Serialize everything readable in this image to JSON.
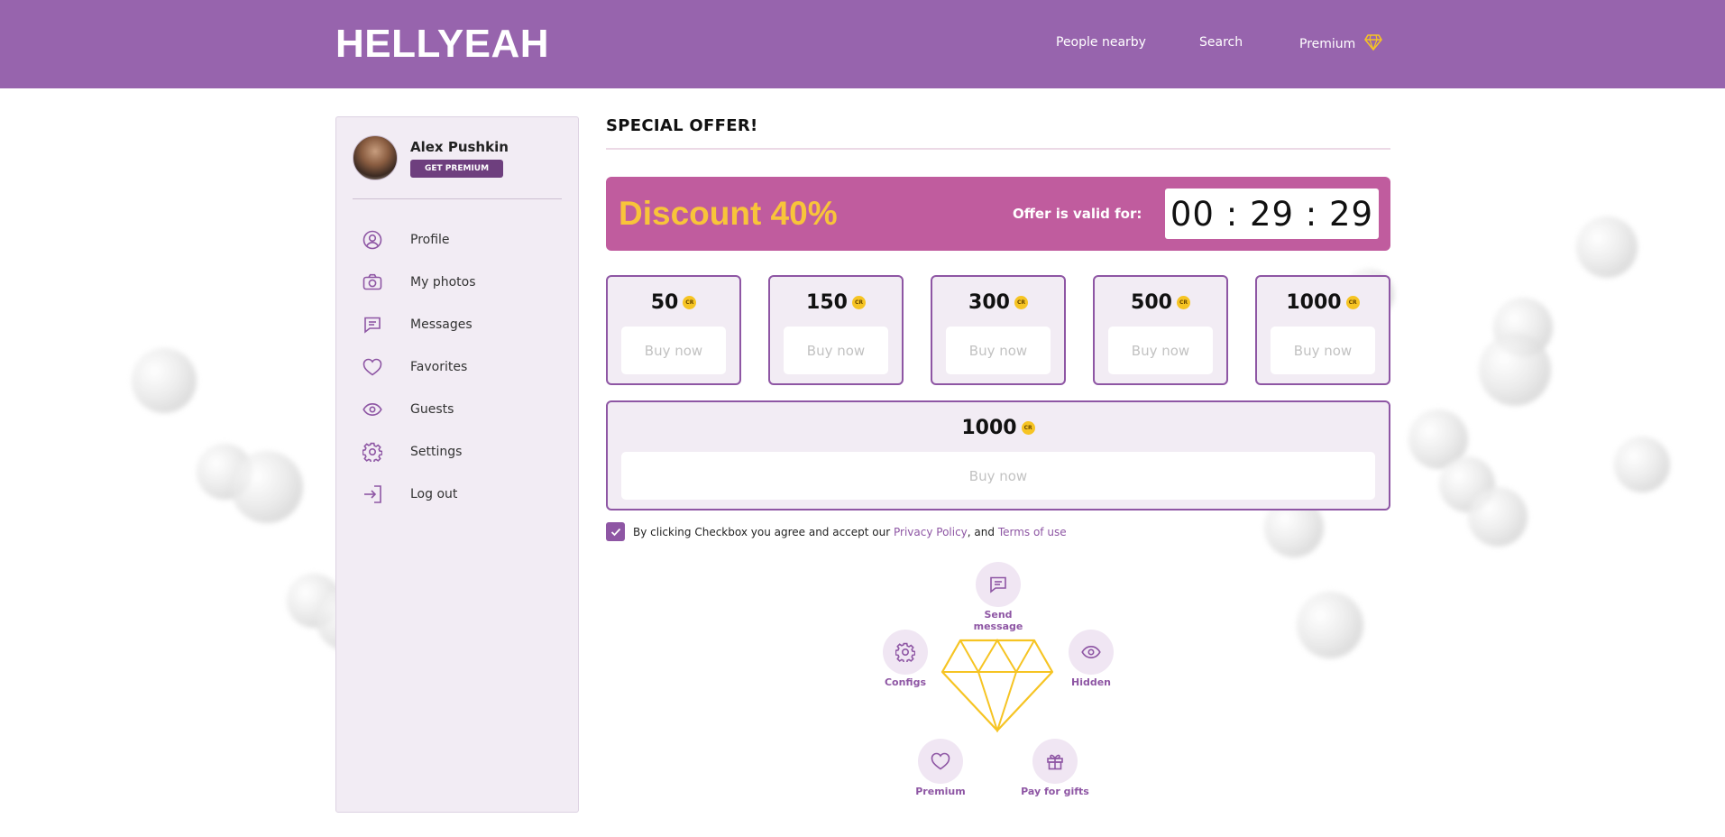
{
  "header": {
    "logo": "HELLYEAH",
    "nav": {
      "people_nearby": "People nearby",
      "search": "Search",
      "premium": "Premium"
    }
  },
  "sidebar": {
    "user": {
      "name": "Alex Pushkin",
      "premium_button": "GET PREMIUM"
    },
    "items": [
      {
        "label": "Profile",
        "icon": "user-circle-icon"
      },
      {
        "label": "My photos",
        "icon": "camera-icon"
      },
      {
        "label": "Messages",
        "icon": "message-icon"
      },
      {
        "label": "Favorites",
        "icon": "heart-icon"
      },
      {
        "label": "Guests",
        "icon": "eye-icon"
      },
      {
        "label": "Settings",
        "icon": "gear-icon"
      },
      {
        "label": "Log out",
        "icon": "logout-icon"
      }
    ]
  },
  "main": {
    "title": "SPECIAL OFFER!",
    "banner": {
      "discount": "Discount 40%",
      "valid_label": "Offer is valid for:",
      "timer": "00 : 29 : 29"
    },
    "packs": [
      {
        "amount": "50",
        "button": "Buy now"
      },
      {
        "amount": "150",
        "button": "Buy now"
      },
      {
        "amount": "300",
        "button": "Buy now"
      },
      {
        "amount": "500",
        "button": "Buy now"
      },
      {
        "amount": "1000",
        "button": "Buy now"
      }
    ],
    "wide_pack": {
      "amount": "1000",
      "button": "Buy now"
    },
    "coin_label": "CR",
    "agreement": {
      "checked": true,
      "text": "By clicking Checkbox you agree and accept our ",
      "privacy": "Privacy Policy",
      "separator": ", and ",
      "terms": "Terms of use"
    },
    "features": {
      "send_message": "Send message",
      "configs": "Configs",
      "hidden": "Hidden",
      "premium": "Premium",
      "pay_for_gifts": "Pay for gifts"
    }
  },
  "colors": {
    "header": "#9764ad",
    "accent": "#8e56a4",
    "banner": "#c05c9e",
    "discount_text": "#f8c43a",
    "sidebar_bg": "#f2ecf4",
    "diamond": "#f6c423"
  }
}
